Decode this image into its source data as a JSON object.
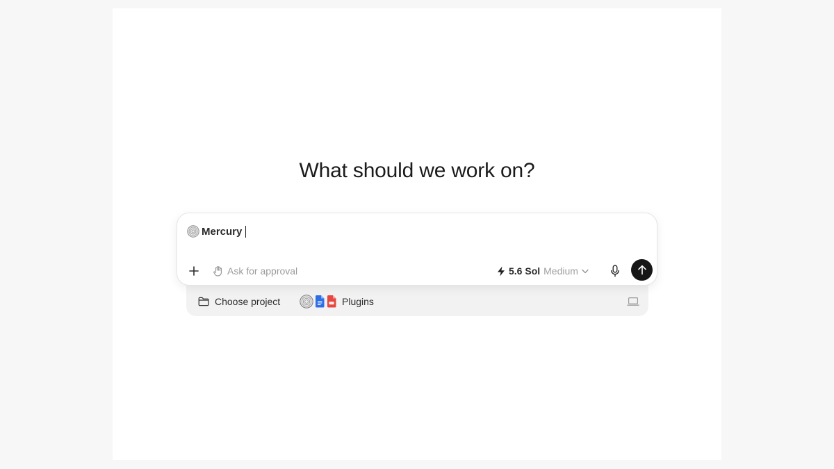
{
  "main": {
    "heading": "What should we work on?"
  },
  "composer": {
    "mention": "Mention",
    "mention_label": "Mercury",
    "approval_label": "Ask for approval",
    "model": {
      "name": "5.6 Sol",
      "effort": "Medium"
    }
  },
  "footer": {
    "project_label": "Choose project",
    "plugins_label": "Plugins",
    "plugin_icons": [
      "mercury-icon",
      "docs-icon",
      "pdf-icon"
    ]
  },
  "colors": {
    "send_button": "#161616",
    "docs_blue": "#2f6fe4",
    "pdf_red": "#e5483e"
  }
}
